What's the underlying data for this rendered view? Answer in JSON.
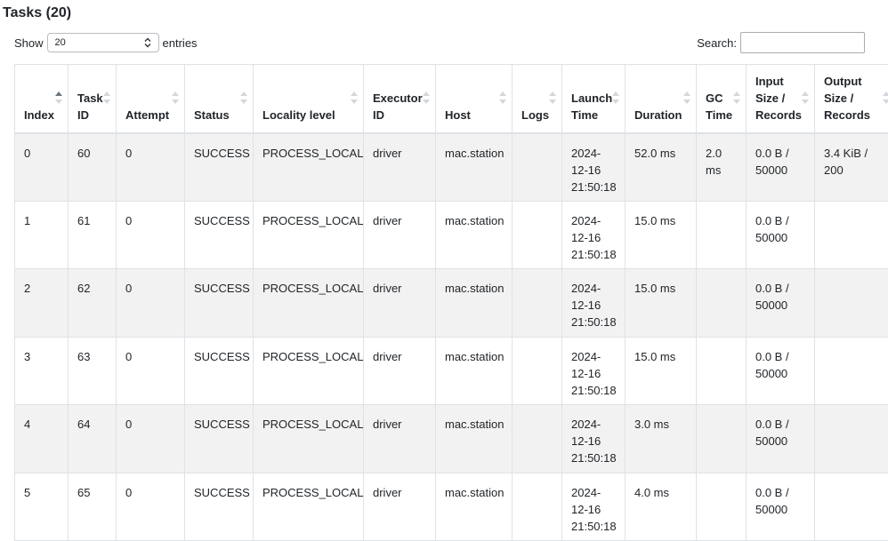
{
  "page_title": "Tasks (20)",
  "length_control": {
    "show_label": "Show",
    "selected": "20",
    "entries_label": "entries"
  },
  "search": {
    "label": "Search:",
    "value": ""
  },
  "columns": [
    "Index",
    "Task ID",
    "Attempt",
    "Status",
    "Locality level",
    "Executor ID",
    "Host",
    "Logs",
    "Launch Time",
    "Duration",
    "GC Time",
    "Input Size / Records",
    "Output Size / Records"
  ],
  "sort": {
    "column": "Index",
    "direction": "ascending"
  },
  "rows": [
    [
      "0",
      "60",
      "0",
      "SUCCESS",
      "PROCESS_LOCAL",
      "driver",
      "mac.station",
      "",
      "2024-12-16 21:50:18",
      "52.0 ms",
      "2.0 ms",
      "0.0 B / 50000",
      "3.4 KiB / 200"
    ],
    [
      "1",
      "61",
      "0",
      "SUCCESS",
      "PROCESS_LOCAL",
      "driver",
      "mac.station",
      "",
      "2024-12-16 21:50:18",
      "15.0 ms",
      "",
      "0.0 B / 50000",
      ""
    ],
    [
      "2",
      "62",
      "0",
      "SUCCESS",
      "PROCESS_LOCAL",
      "driver",
      "mac.station",
      "",
      "2024-12-16 21:50:18",
      "15.0 ms",
      "",
      "0.0 B / 50000",
      ""
    ],
    [
      "3",
      "63",
      "0",
      "SUCCESS",
      "PROCESS_LOCAL",
      "driver",
      "mac.station",
      "",
      "2024-12-16 21:50:18",
      "15.0 ms",
      "",
      "0.0 B / 50000",
      ""
    ],
    [
      "4",
      "64",
      "0",
      "SUCCESS",
      "PROCESS_LOCAL",
      "driver",
      "mac.station",
      "",
      "2024-12-16 21:50:18",
      "3.0 ms",
      "",
      "0.0 B / 50000",
      ""
    ],
    [
      "5",
      "65",
      "0",
      "SUCCESS",
      "PROCESS_LOCAL",
      "driver",
      "mac.station",
      "",
      "2024-12-16 21:50:18",
      "4.0 ms",
      "",
      "0.0 B / 50000",
      ""
    ]
  ],
  "colors": {
    "stripe": "#f2f2f2",
    "border": "#dee2e6",
    "sort_active": "#6c757d",
    "sort_inactive": "#d4d7da"
  }
}
